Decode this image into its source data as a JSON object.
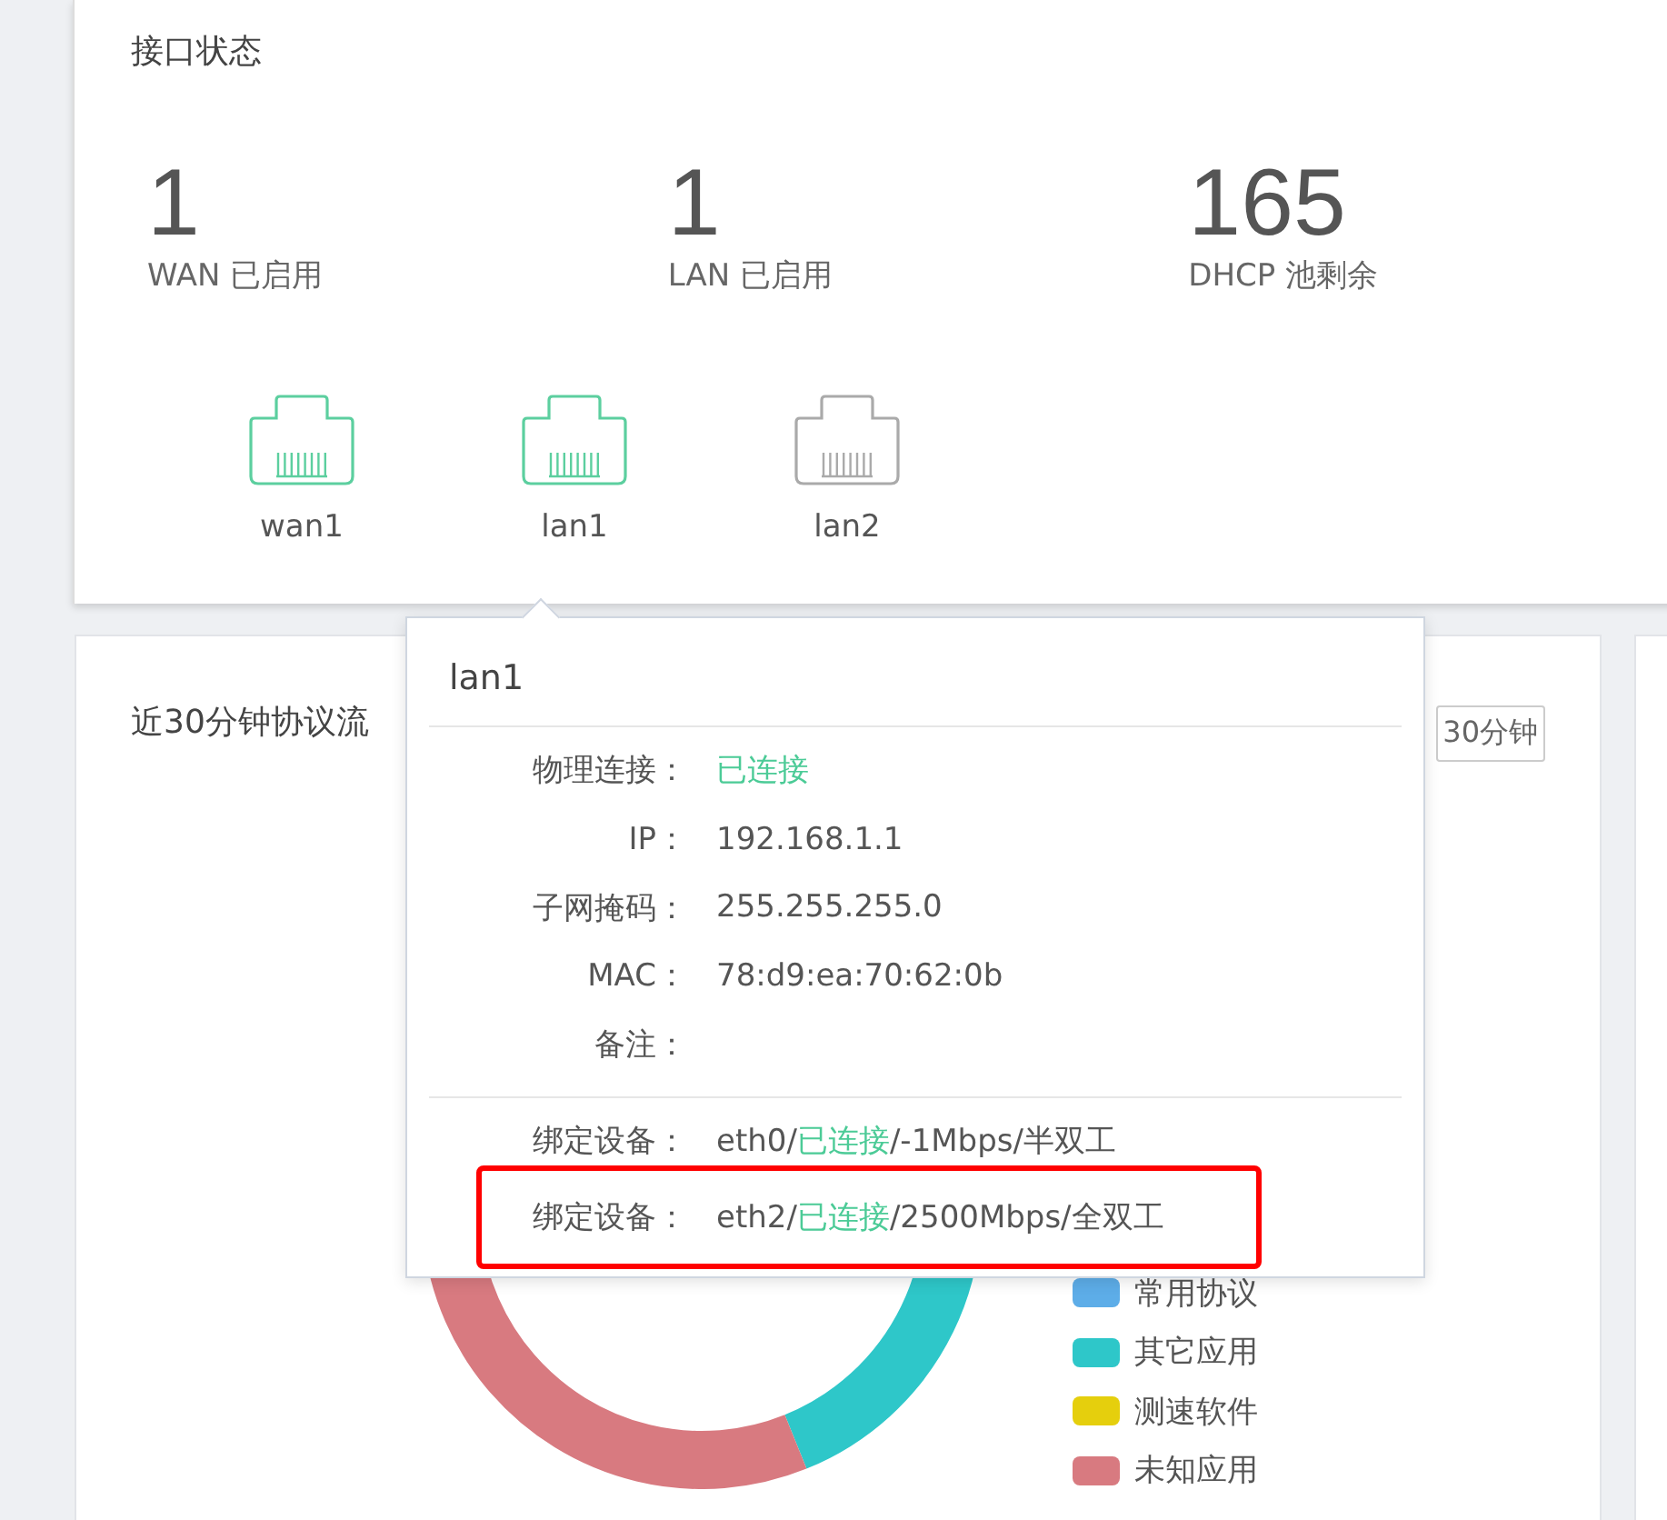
{
  "interface_status": {
    "title": "接口状态",
    "stats": [
      {
        "value": "1",
        "label": "WAN 已启用"
      },
      {
        "value": "1",
        "label": "LAN 已启用"
      },
      {
        "value": "165",
        "label": "DHCP 池剩余"
      }
    ],
    "ports": [
      {
        "name": "wan1",
        "connected": true
      },
      {
        "name": "lan1",
        "connected": true
      },
      {
        "name": "lan2",
        "connected": false
      }
    ]
  },
  "traffic_card": {
    "title": "近30分钟协议流",
    "range_button": "30分钟",
    "legend": [
      {
        "label": "常用协议",
        "color": "#5dade8"
      },
      {
        "label": "其它应用",
        "color": "#2ec7c9"
      },
      {
        "label": "测速软件",
        "color": "#e5cf0d"
      },
      {
        "label": "未知应用",
        "color": "#d87a80"
      }
    ]
  },
  "port_tooltip": {
    "title": "lan1",
    "details": [
      {
        "label": "物理连接：",
        "parts": [
          {
            "text": "已连接",
            "kind": "status"
          }
        ]
      },
      {
        "label": "IP：",
        "parts": [
          {
            "text": "192.168.1.1",
            "kind": "plain"
          }
        ]
      },
      {
        "label": "子网掩码：",
        "parts": [
          {
            "text": "255.255.255.0",
            "kind": "plain"
          }
        ]
      },
      {
        "label": "MAC：",
        "parts": [
          {
            "text": "78:d9:ea:70:62:0b",
            "kind": "plain"
          }
        ]
      },
      {
        "label": "备注："
      }
    ],
    "bindings": [
      {
        "label": "绑定设备：",
        "highlighted": false,
        "parts": [
          {
            "text": "eth0/",
            "kind": "plain"
          },
          {
            "text": "已连接",
            "kind": "status"
          },
          {
            "text": "/-1Mbps/半双工",
            "kind": "plain"
          }
        ]
      },
      {
        "label": "绑定设备：",
        "highlighted": true,
        "parts": [
          {
            "text": "eth2/",
            "kind": "plain"
          },
          {
            "text": "已连接",
            "kind": "status"
          },
          {
            "text": "/2500Mbps/全双工",
            "kind": "plain"
          }
        ]
      }
    ]
  }
}
